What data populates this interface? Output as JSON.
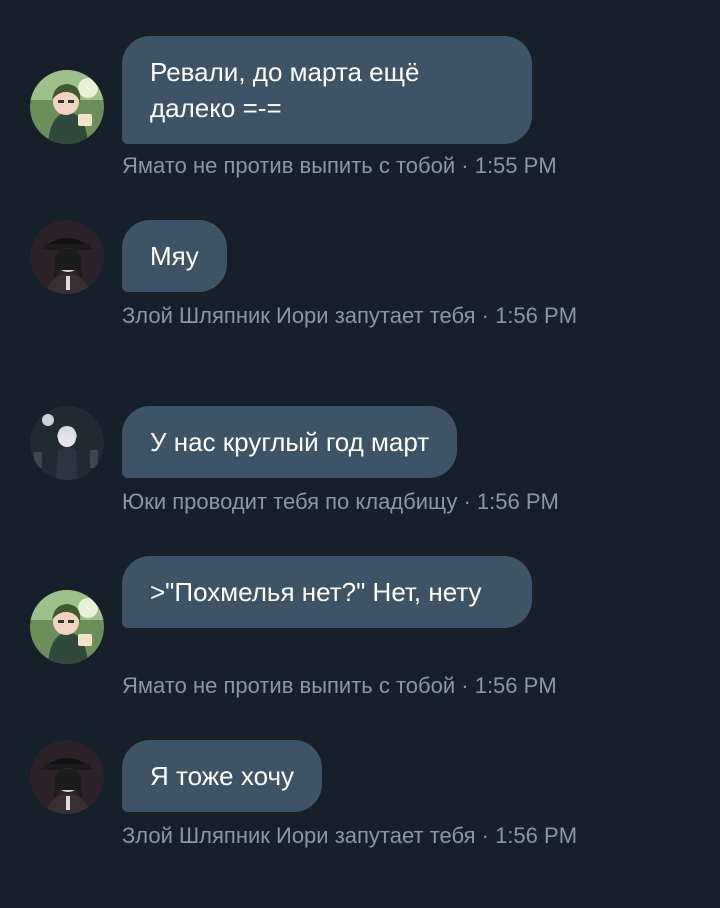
{
  "messages": [
    {
      "text": "Ревали, до марта ещё далеко =-=",
      "meta": "Ямато не против выпить с тобой · 1:55 PM",
      "avatar": "yamato-avatar"
    },
    {
      "text": "Мяу",
      "meta": "Злой Шляпник Иори запутает тебя · 1:56 PM",
      "avatar": "iori-avatar"
    },
    {
      "text": "У нас круглый год март",
      "meta": "Юки проводит тебя по кладбищу · 1:56 PM",
      "avatar": "yuki-avatar"
    },
    {
      "text": ">\"Похмелья нет?\" Нет, нету",
      "meta": "Ямато не против выпить с тобой · 1:56 PM",
      "avatar": "yamato-avatar"
    },
    {
      "text": "Я тоже хочу",
      "meta": "Злой Шляпник Иори запутает тебя · 1:56 PM",
      "avatar": "iori-avatar"
    }
  ],
  "colors": {
    "background": "#15202b",
    "bubble": "#3d5466",
    "meta_text": "#8899a6",
    "message_text": "#ffffff"
  }
}
